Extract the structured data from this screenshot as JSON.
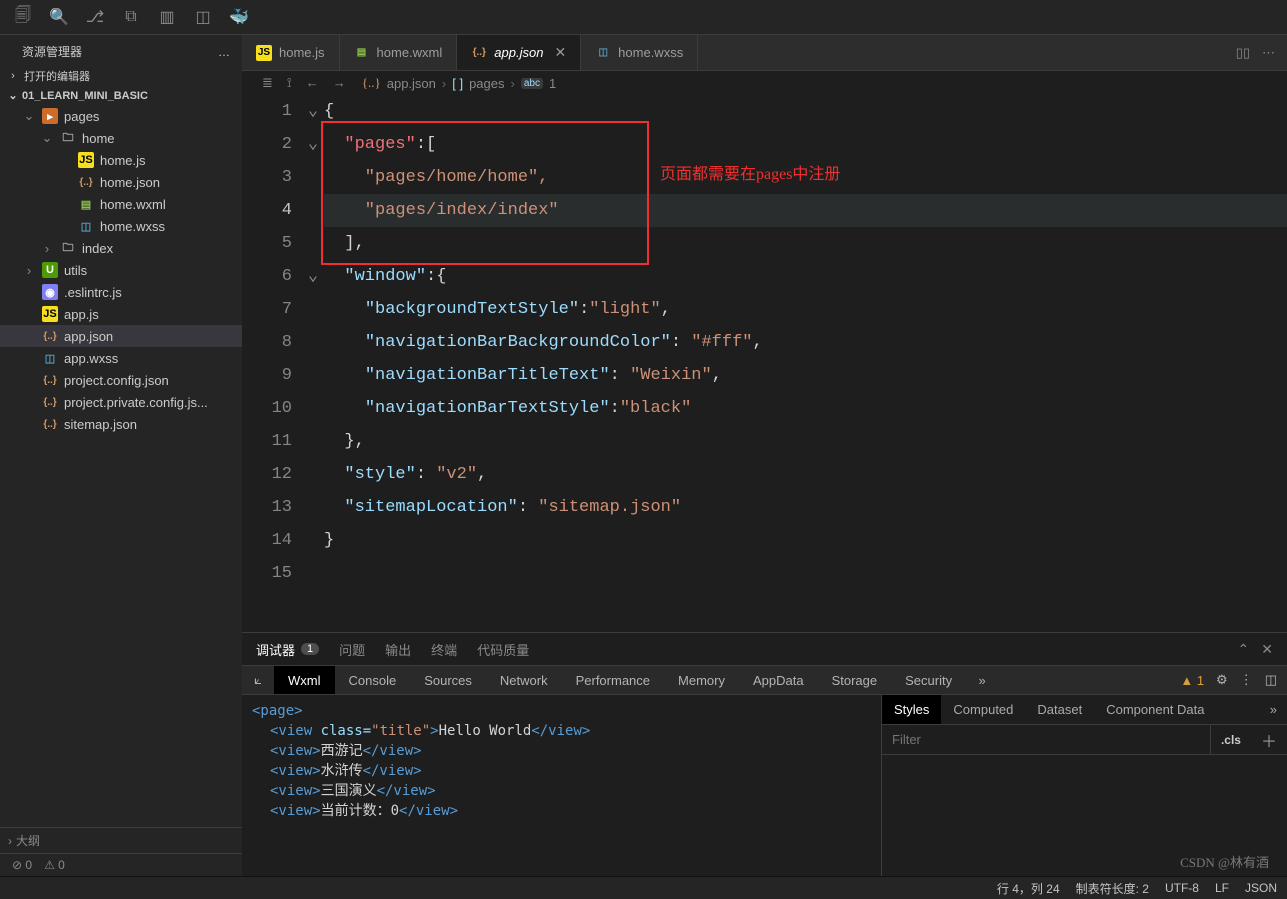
{
  "titlebar_icons": [
    "files",
    "search",
    "source-control",
    "merge",
    "layout",
    "split",
    "docker"
  ],
  "sidebar": {
    "title": "资源管理器",
    "more_icon": "…",
    "open_editors": "打开的编辑器",
    "project": "01_LEARN_MINI_BASIC",
    "tree": [
      {
        "name": "pages",
        "type": "folder-root",
        "indent": 1,
        "expanded": true
      },
      {
        "name": "home",
        "type": "folder",
        "indent": 2,
        "expanded": true
      },
      {
        "name": "home.js",
        "type": "js",
        "indent": 3
      },
      {
        "name": "home.json",
        "type": "json",
        "indent": 3
      },
      {
        "name": "home.wxml",
        "type": "wxml",
        "indent": 3
      },
      {
        "name": "home.wxss",
        "type": "wxss",
        "indent": 3
      },
      {
        "name": "index",
        "type": "folder",
        "indent": 2,
        "expanded": false
      },
      {
        "name": "utils",
        "type": "folder-green",
        "indent": 1,
        "expanded": false
      },
      {
        "name": ".eslintrc.js",
        "type": "eslint",
        "indent": 1
      },
      {
        "name": "app.js",
        "type": "js",
        "indent": 1
      },
      {
        "name": "app.json",
        "type": "json",
        "indent": 1,
        "selected": true
      },
      {
        "name": "app.wxss",
        "type": "wxss",
        "indent": 1
      },
      {
        "name": "project.config.json",
        "type": "json",
        "indent": 1
      },
      {
        "name": "project.private.config.js...",
        "type": "json",
        "indent": 1
      },
      {
        "name": "sitemap.json",
        "type": "json",
        "indent": 1
      }
    ],
    "outline": "大纲",
    "errors": "0",
    "warnings": "0"
  },
  "tabs": [
    {
      "icon": "js",
      "label": "home.js"
    },
    {
      "icon": "wxml",
      "label": "home.wxml"
    },
    {
      "icon": "json",
      "label": "app.json",
      "active": true,
      "italic": true,
      "closable": true
    },
    {
      "icon": "wxss",
      "label": "home.wxss"
    }
  ],
  "breadcrumb": {
    "file_icon": "json",
    "file": "app.json",
    "seg1_icon": "[ ]",
    "seg1": "pages",
    "seg2_icon": "abc",
    "seg2": "1"
  },
  "code": {
    "current_line": 4,
    "lines": [
      "1",
      "2",
      "3",
      "4",
      "5",
      "6",
      "7",
      "8",
      "9",
      "10",
      "11",
      "12",
      "13",
      "14",
      "15"
    ],
    "folds": {
      "1": true,
      "2": true,
      "6": true
    },
    "annotation": "页面都需要在pages中注册",
    "l1": "{",
    "l2_key": "\"pages\"",
    "l2_after": ":[",
    "l3": "    \"pages/home/home\",",
    "l4": "    \"pages/index/index\"",
    "l5": "],",
    "l6_key": "\"window\"",
    "l6_after": ":{",
    "l7_key": "\"backgroundTextStyle\"",
    "l7_val": "\"light\"",
    "l8_key": "\"navigationBarBackgroundColor\"",
    "l8_val": "\"#fff\"",
    "l9_key": "\"navigationBarTitleText\"",
    "l9_val": "\"Weixin\"",
    "l10_key": "\"navigationBarTextStyle\"",
    "l10_val": "\"black\"",
    "l11": "},",
    "l12_key": "\"style\"",
    "l12_val": "\"v2\"",
    "l13_key": "\"sitemapLocation\"",
    "l13_val": "\"sitemap.json\"",
    "l14": "}"
  },
  "panel": {
    "tabs": [
      "调试器",
      "问题",
      "输出",
      "终端",
      "代码质量"
    ],
    "active_tab": "调试器",
    "badge": "1",
    "devtools": [
      "Wxml",
      "Console",
      "Sources",
      "Network",
      "Performance",
      "Memory",
      "AppData",
      "Storage",
      "Security"
    ],
    "devtools_active": "Wxml",
    "warn_count": "1",
    "wxml": {
      "page": "<page>",
      "row1_open": "<view ",
      "row1_attr": "class=",
      "row1_val": "\"title\"",
      "row1_close": ">",
      "row1_txt": "Hello World",
      "row1_end": "</view>",
      "row2_open": "<view>",
      "row2_txt": "西游记",
      "row2_end": "</view>",
      "row3_open": "<view>",
      "row3_txt": "水浒传",
      "row3_end": "</view>",
      "row4_open": "<view>",
      "row4_txt": "三国演义",
      "row4_end": "</view>",
      "row5_open": "<view>",
      "row5_txt": "当前计数：0",
      "row5_end": "</view>"
    },
    "styles_tabs": [
      "Styles",
      "Computed",
      "Dataset",
      "Component Data"
    ],
    "styles_active": "Styles",
    "filter_placeholder": "Filter",
    "cls": ".cls"
  },
  "statusbar": {
    "cursor": "行 4，列 24",
    "tabsize": "制表符长度: 2",
    "encoding": "UTF-8",
    "eol": "LF",
    "lang": "JSON"
  },
  "watermark": "CSDN @林有酒"
}
